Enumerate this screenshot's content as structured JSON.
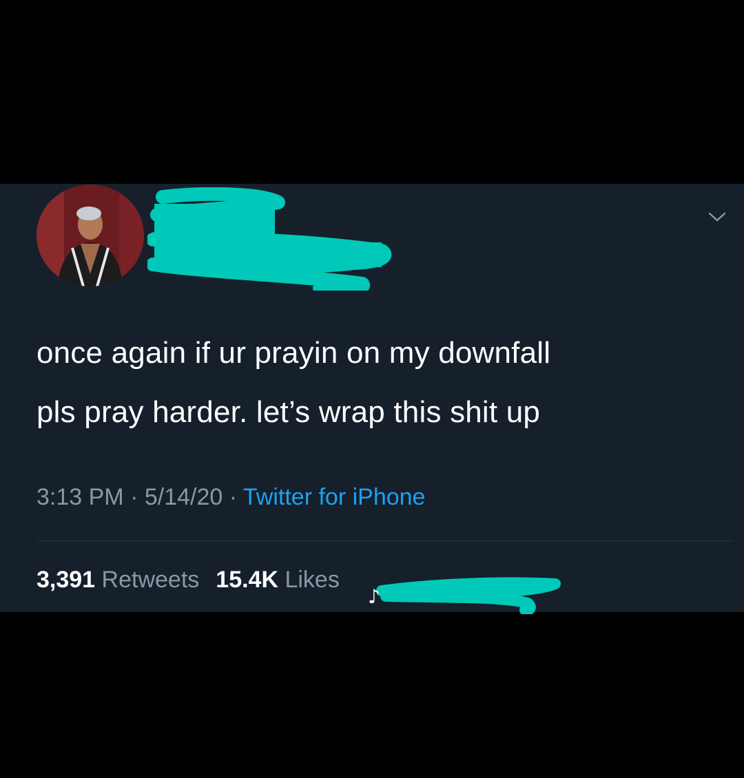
{
  "tweet": {
    "text_line_1": "once again if ur prayin on my downfall",
    "text_line_2": "pls pray harder. let’s wrap this shit up",
    "time": "3:13 PM",
    "separator": " · ",
    "date": "5/14/20",
    "source": "Twitter for iPhone"
  },
  "stats": {
    "retweets_count": "3,391",
    "retweets_label": " Retweets",
    "likes_count": "15.4K",
    "likes_label": " Likes"
  },
  "icons": {
    "menu": "chevron-down-icon"
  },
  "colors": {
    "background": "#15202b",
    "text": "#ffffff",
    "muted": "#8899a6",
    "link": "#1da1f2",
    "redaction": "#00c9b9"
  }
}
